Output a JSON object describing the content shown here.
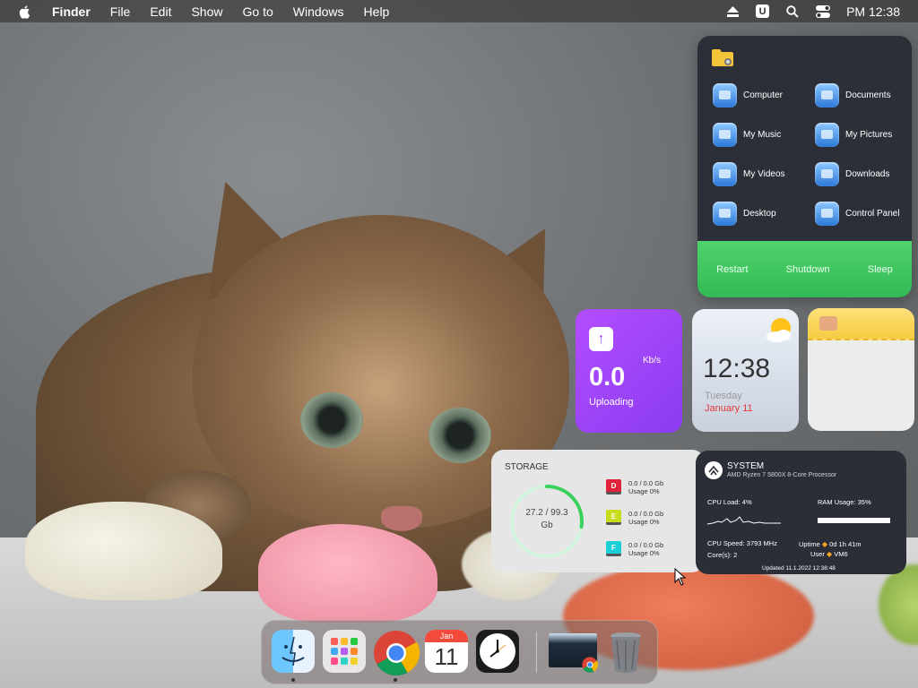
{
  "menubar": {
    "app_name": "Finder",
    "menus": [
      "File",
      "Edit",
      "Show",
      "Go to",
      "Windows",
      "Help"
    ],
    "status_u": "U",
    "clock": "PM 12:38"
  },
  "folders": {
    "items": [
      "Computer",
      "Documents",
      "My Music",
      "My Pictures",
      "My Videos",
      "Downloads",
      "Desktop",
      "Control Panel"
    ],
    "power": [
      "Restart",
      "Shutdown",
      "Sleep"
    ],
    "accent": "#3cc55f"
  },
  "upload": {
    "unit": "Kb/s",
    "value": "0.0",
    "label": "Uploading",
    "accent": "#9b44f5"
  },
  "clock": {
    "time": "12:38",
    "day": "Tuesday",
    "date": "January 11"
  },
  "storage": {
    "title": "STORAGE",
    "used": "27.2 / 99.3",
    "unit": "Gb",
    "used_fraction": 0.274,
    "drives": [
      {
        "letter": "D",
        "size": "0.0 / 0.0 Gb",
        "usage": "Usage 0%",
        "color": "#e0223a"
      },
      {
        "letter": "E",
        "size": "0.0 / 0.0 Gb",
        "usage": "Usage 0%",
        "color": "#c8dc1c"
      },
      {
        "letter": "F",
        "size": "0.0 / 0.0 Gb",
        "usage": "Usage 0%",
        "color": "#18d0d6"
      }
    ]
  },
  "system": {
    "title": "SYSTEM",
    "cpu_name": "AMD Ryzen 7 5800X 8-Core Processor",
    "cpu_load": "CPU Load: 4%",
    "ram_usage": "RAM Usage: 35%",
    "cpu_speed": "CPU Speed: 3793 MHz",
    "cores": "Core(s): 2",
    "uptime_label": "Uptime",
    "uptime_value": "0d 1h 41m",
    "user_label": "User",
    "user_value": "VM6",
    "updated": "Updated 11.1.2022 12:38:48"
  },
  "dock": {
    "calendar_month": "Jan",
    "calendar_day": "11",
    "apps": [
      "finder-icon",
      "launchpad-icon",
      "chrome-icon",
      "calendar-icon",
      "clock-icon",
      "window-preview-icon",
      "trash-icon"
    ]
  }
}
